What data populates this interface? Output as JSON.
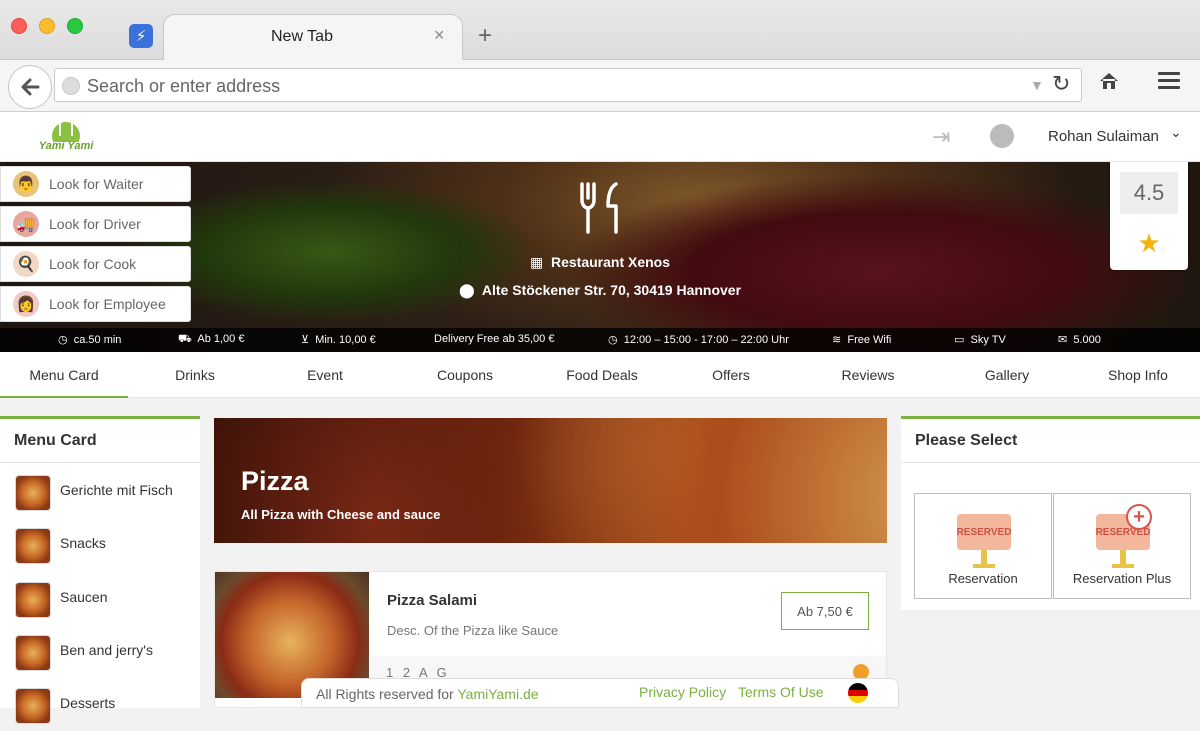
{
  "browser": {
    "tab_title": "New Tab",
    "address_placeholder": "Search or enter address",
    "new_tab_symbol": "+",
    "tab_close_symbol": "×"
  },
  "site": {
    "logo_text": "Yami Yami",
    "user_name": "Rohan Sulaiman"
  },
  "side_buttons": [
    {
      "label": "Look for Waiter"
    },
    {
      "label": "Look for Driver"
    },
    {
      "label": "Look for Cook"
    },
    {
      "label": "Look for Employee"
    }
  ],
  "restaurant": {
    "name": "Restaurant Xenos",
    "address": "Alte Stöckener Str. 70, 30419 Hannover",
    "rating": "4.5"
  },
  "info_bar": [
    {
      "icon": "clock-icon",
      "text": "ca.50 min"
    },
    {
      "icon": "truck-icon",
      "text": "Ab 1,00 €"
    },
    {
      "icon": "cart-icon",
      "text": "Min. 10,00 €"
    },
    {
      "icon": "",
      "text": "Delivery Free ab 35,00 €"
    },
    {
      "icon": "clock-icon",
      "text": "12:00 – 15:00 - 17:00 – 22:00 Uhr"
    },
    {
      "icon": "wifi-icon",
      "text": "Free Wifi"
    },
    {
      "icon": "tv-icon",
      "text": "Sky TV"
    },
    {
      "icon": "comments-icon",
      "text": "5.000"
    }
  ],
  "nav_tabs": [
    "Menu Card",
    "Drinks",
    "Event",
    "Coupons",
    "Food Deals",
    "Offers",
    "Reviews",
    "Gallery",
    "Shop Info"
  ],
  "menu_card": {
    "title": "Menu Card",
    "items": [
      "Gerichte mit Fisch",
      "Snacks",
      "Saucen",
      "Ben and jerry's",
      "Desserts"
    ]
  },
  "category_banner": {
    "title": "Pizza",
    "subtitle": "All Pizza with Cheese and sauce"
  },
  "product": {
    "name": "Pizza Salami",
    "description": "Desc. Of the Pizza like Sauce",
    "price": "Ab 7,50 €",
    "tags": "1 2 A G"
  },
  "please_select": {
    "title": "Please Select",
    "sign_text": "RESERVED",
    "options": [
      "Reservation",
      "Reservation Plus"
    ]
  },
  "footer": {
    "rights_prefix": "All Rights reserved for ",
    "brand": "YamiYami.de",
    "privacy": "Privacy Policy",
    "terms": "Terms Of Use"
  },
  "colors": {
    "accent": "#7bb043",
    "rating_star": "#f5b40c"
  }
}
